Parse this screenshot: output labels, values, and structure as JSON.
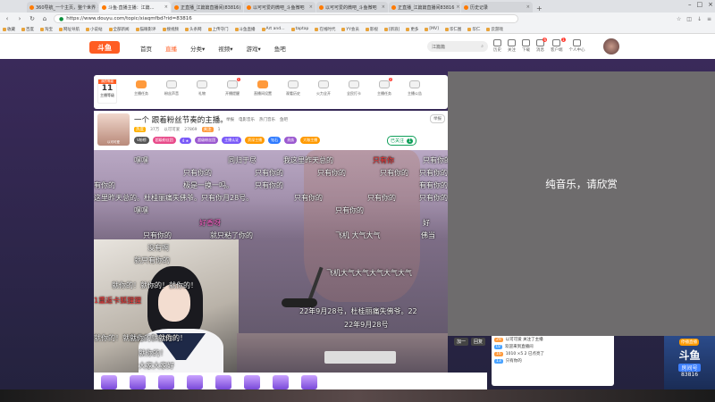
{
  "browser": {
    "tabs": [
      {
        "title": "360导航_一个主页，整个世界",
        "active": false
      },
      {
        "title": "斗鱼·直播主播：江篇…",
        "active": true
      },
      {
        "title": "正直播_江篇篇直播间(83816)",
        "active": false
      },
      {
        "title": "以可可爱的微吧_斗鱼微吧",
        "active": false
      },
      {
        "title": "以可可爱的微吧_斗鱼微吧",
        "active": false
      },
      {
        "title": "正直播_江篇篇直播间83816",
        "active": false
      },
      {
        "title": "历史记录",
        "active": false
      }
    ],
    "url": "https://www.douyu.com/topic/xiaqmfbd?rid=83816",
    "bookmarks": [
      "收藏",
      "百度",
      "淘宝",
      "网址导航",
      "小说站",
      "全部新闻",
      "猫眼影评",
      "搜视频",
      "头条网",
      "上传守门",
      "斗鱼直播",
      "Art and…",
      "taptap",
      "在线时代",
      "YY会员",
      "影视",
      "[新浪]",
      "更多",
      "[MV]",
      "华仁图",
      "华仁",
      "云游戏"
    ]
  },
  "douyu": {
    "logo": "斗鱼",
    "nav": [
      {
        "label": "首页",
        "active": false
      },
      {
        "label": "直播",
        "active": true
      },
      {
        "label": "分类▾",
        "active": false
      },
      {
        "label": "视频▾",
        "active": false
      },
      {
        "label": "游戏▾",
        "active": false
      },
      {
        "label": "鱼吧",
        "active": false
      }
    ],
    "search_text": "江篇篇",
    "right_nav": [
      {
        "label": "历史",
        "badge": ""
      },
      {
        "label": "关注",
        "badge": ""
      },
      {
        "label": "下载",
        "badge": ""
      },
      {
        "label": "消息",
        "badge": "6"
      },
      {
        "label": "客户端",
        "badge": "1"
      },
      {
        "label": "个人中心",
        "badge": ""
      }
    ]
  },
  "room": {
    "level_tag": "我的等级",
    "level": "11",
    "level_sub": "主播等级",
    "tools": [
      {
        "label": "主播任务",
        "badge": ""
      },
      {
        "label": "粉丝声音",
        "badge": ""
      },
      {
        "label": "礼物",
        "badge": ""
      },
      {
        "label": "开播提醒",
        "badge": "1"
      },
      {
        "label": "直播间设置",
        "badge": ""
      },
      {
        "label": "观看历史",
        "badge": ""
      },
      {
        "label": "火力全开",
        "badge": ""
      },
      {
        "label": "全民打卡",
        "badge": ""
      },
      {
        "label": "主播任务",
        "badge": "2"
      },
      {
        "label": "主播公告",
        "badge": ""
      }
    ],
    "title": "一个 跟着粉丝节奏的主播。",
    "crumbs": [
      "举报",
      "电影音乐",
      "热门音乐",
      "鱼吧"
    ],
    "report": "举报",
    "anchor_name": "以可可爱",
    "hot_label": "热度",
    "hot_value": "37万",
    "follow_label": "关注",
    "follow_value": "1",
    "fans_text": "以可可爱",
    "fans_count": "27869",
    "badges": [
      {
        "text": "V粉榜",
        "color": "#555"
      },
      {
        "text": "超级粉丝团",
        "color": "#e84b8a"
      },
      {
        "text": "4 ★",
        "color": "#7a5af8"
      },
      {
        "text": "超级粉丝团",
        "color": "#9b59d0"
      },
      {
        "text": "主播认证",
        "color": "#7a5af8"
      },
      {
        "text": "资深主播",
        "color": "#ff9a00"
      },
      {
        "text": "钻石",
        "color": "#2f7bff"
      },
      {
        "text": "贵族",
        "color": "#9b59d0"
      },
      {
        "text": "大咖主播",
        "color": "#ff9a00"
      }
    ],
    "follow_btn": "已关注",
    "follow_count": "1"
  },
  "danmaku": [
    {
      "text": "嘿嘿",
      "color": "white"
    },
    {
      "text": "同归于尽",
      "color": "white"
    },
    {
      "text": "我这里昨天总的",
      "color": "white"
    },
    {
      "text": "只有你",
      "color": "red"
    },
    {
      "text": "只有你的",
      "color": "white"
    },
    {
      "text": "只有你的",
      "color": "white"
    },
    {
      "text": "只有你的",
      "color": "white"
    },
    {
      "text": "只有你的",
      "color": "white"
    },
    {
      "text": "只有你的",
      "color": "white"
    },
    {
      "text": "只有你的",
      "color": "white"
    },
    {
      "text": "有你的",
      "color": "white"
    },
    {
      "text": "极是一换一吗。",
      "color": "white"
    },
    {
      "text": "只有你的",
      "color": "white"
    },
    {
      "text": "有有你的",
      "color": "white"
    },
    {
      "text": "这里昨天总的。杜桂丽痛失佛爷。只有你月28号。",
      "color": "white"
    },
    {
      "text": "只有你的",
      "color": "white"
    },
    {
      "text": "只有你的",
      "color": "white"
    },
    {
      "text": "只有你的",
      "color": "white"
    },
    {
      "text": "嘿嘿",
      "color": "white"
    },
    {
      "text": "好香呀",
      "color": "pink"
    },
    {
      "text": "只有你的",
      "color": "white"
    },
    {
      "text": "好",
      "color": "white"
    },
    {
      "text": "佛当",
      "color": "white"
    },
    {
      "text": "只有你的",
      "color": "white"
    },
    {
      "text": "就只粘了你的",
      "color": "white"
    },
    {
      "text": "飞机 大气大气",
      "color": "white"
    },
    {
      "text": "没有啊",
      "color": "white"
    },
    {
      "text": "就只有你的",
      "color": "white"
    },
    {
      "text": "飞机大气大气大气大气大气",
      "color": "white"
    },
    {
      "text": "就你的！就你的！就你的！",
      "color": "white"
    },
    {
      "text": "1重返卡狐狸狸",
      "color": "red"
    },
    {
      "text": "就你的！就你的！就你的！",
      "color": "white"
    },
    {
      "text": "22年9月28号，杜桂丽痛失佛爷。22",
      "color": "white"
    },
    {
      "text": "22年9月28号",
      "color": "white"
    },
    {
      "text": "就你的！就你的！",
      "color": "white"
    },
    {
      "text": "就你的！",
      "color": "white"
    },
    {
      "text": "大家大家好",
      "color": "white"
    }
  ],
  "overlay": {
    "text": "纯音乐，请欣赏"
  },
  "chat": {
    "tabs": [
      "加一",
      "回复"
    ],
    "lines": [
      {
        "level": "29",
        "text": "以可可爱 关注了主播"
      },
      {
        "level": "LV",
        "text": "欢迎来到直播间"
      },
      {
        "level": "16",
        "text": "1010 ×5 2 已点亮了"
      },
      {
        "level": "13",
        "text": "只有你的"
      }
    ]
  },
  "ad": {
    "logo": "斗鱼",
    "sub": "房间号",
    "number": "83816",
    "tag": "停播直播"
  },
  "colors": {
    "brand": "#ff5d23",
    "overlay": "#6e6c6d"
  }
}
